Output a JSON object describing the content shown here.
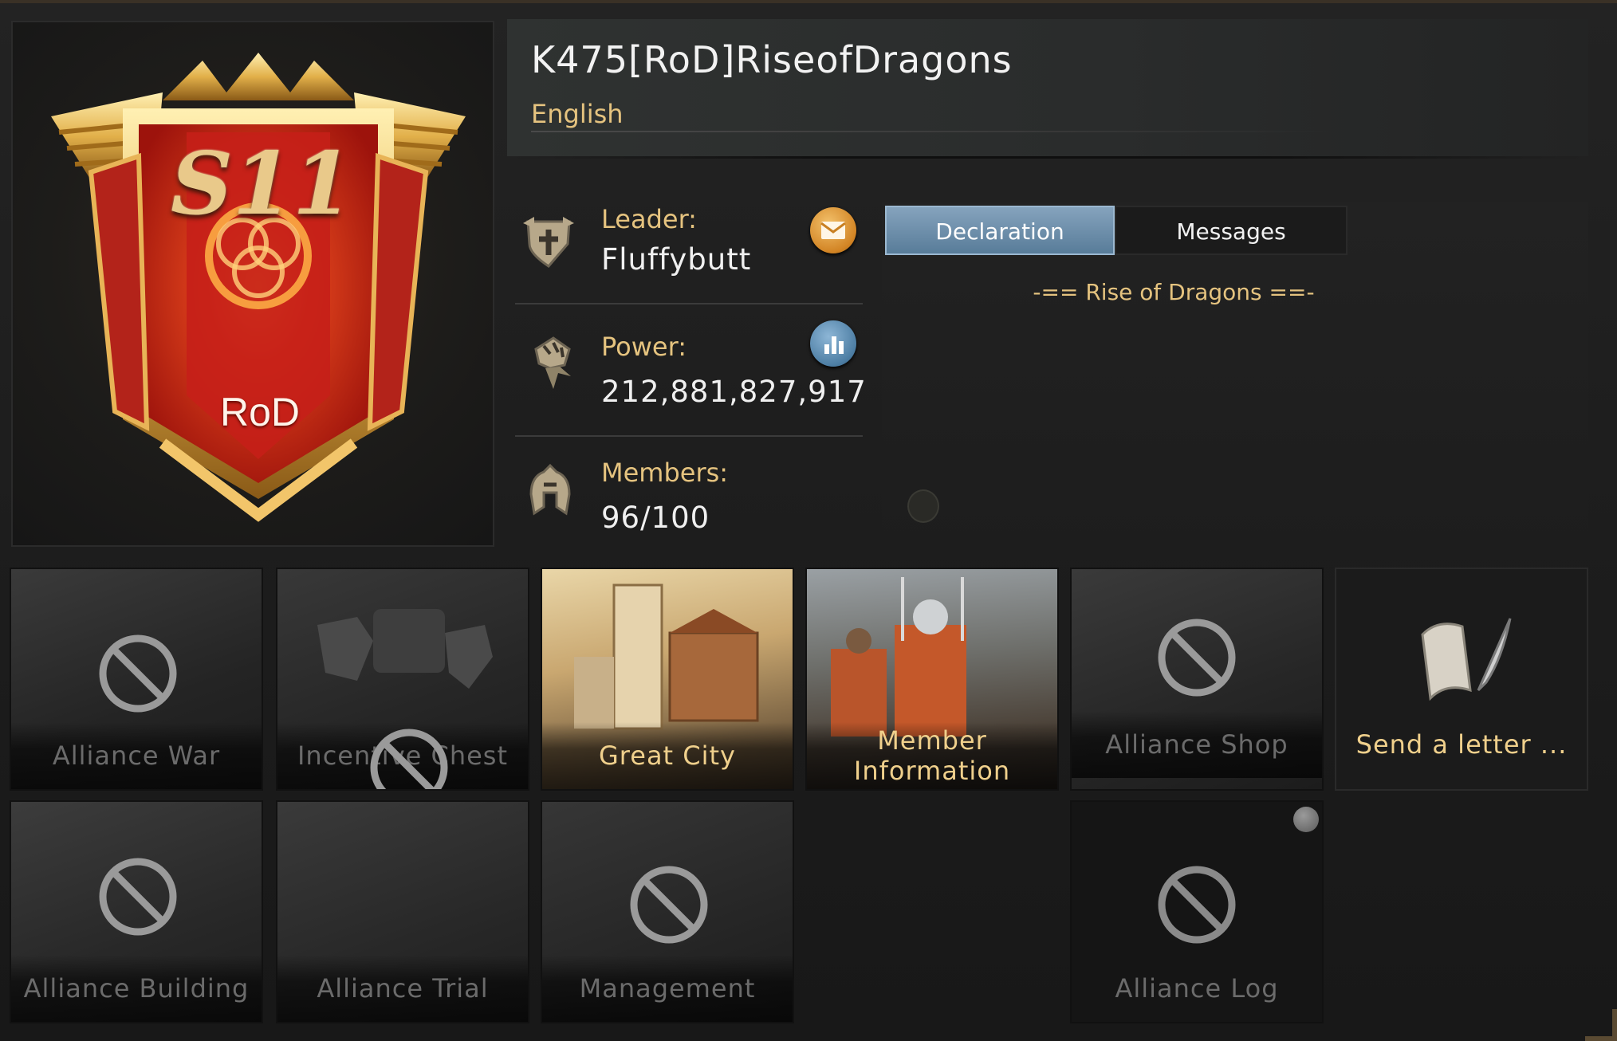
{
  "alliance": {
    "name": "K475[RoD]RiseofDragons",
    "language": "English",
    "emblem": {
      "season": "S11",
      "tag": "RoD"
    }
  },
  "stats": {
    "leader": {
      "label": "Leader:",
      "value": "Fluffybutt",
      "icon": "leader-shield-icon",
      "action_icon": "mail-icon"
    },
    "power": {
      "label": "Power:",
      "value": "212,881,827,917",
      "icon": "power-fist-icon",
      "action_icon": "bar-chart-icon"
    },
    "members": {
      "label": "Members:",
      "value": "96/100",
      "icon": "helmet-icon"
    }
  },
  "tabs": [
    {
      "label": "Declaration",
      "active": true
    },
    {
      "label": "Messages",
      "active": false
    }
  ],
  "declaration": {
    "text": "-==  Rise of Dragons ==-"
  },
  "tiles": [
    {
      "label": "Alliance War",
      "enabled": false
    },
    {
      "label": "Incentive Chest",
      "enabled": false
    },
    {
      "label": "Great City",
      "enabled": true
    },
    {
      "label": "Member Information",
      "enabled": true
    },
    {
      "label": "Alliance Shop",
      "enabled": false
    },
    {
      "label": "Send a letter ...",
      "enabled": true
    },
    {
      "label": "Alliance Building",
      "enabled": false
    },
    {
      "label": "Alliance Trial",
      "enabled": false
    },
    {
      "label": "Management",
      "enabled": false
    },
    {
      "label": "Alliance Log",
      "enabled": false,
      "notification": true
    }
  ],
  "colors": {
    "gold_text": "#e5c37f",
    "tab_active": "#6d8fab",
    "disabled_text": "#6b6b6b",
    "banner_red": "#c8281a"
  }
}
